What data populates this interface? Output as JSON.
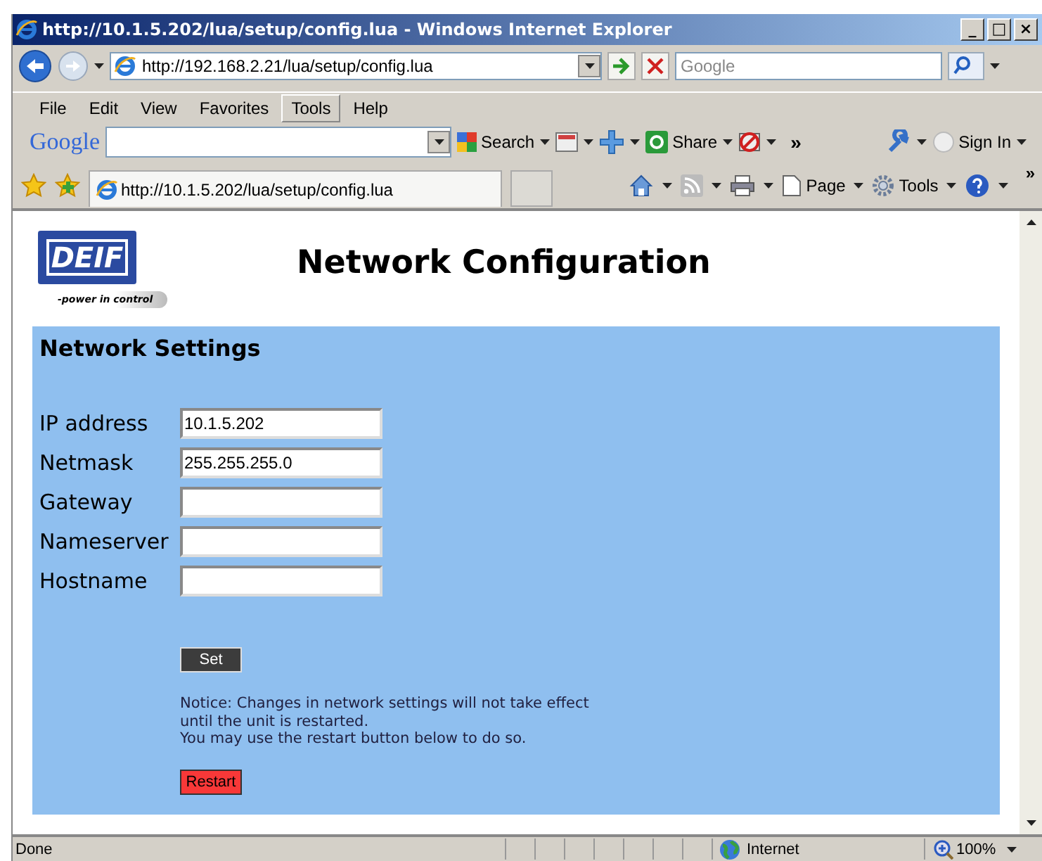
{
  "window": {
    "title": "http://10.1.5.202/lua/setup/config.lua - Windows Internet Explorer",
    "controls": [
      "_",
      "□",
      "×"
    ]
  },
  "nav": {
    "address": "http://192.168.2.21/lua/setup/config.lua",
    "search": {
      "placeholder": "Google"
    }
  },
  "menu": [
    {
      "label": "File",
      "selected": false
    },
    {
      "label": "Edit",
      "selected": false
    },
    {
      "label": "View",
      "selected": false
    },
    {
      "label": "Favorites",
      "selected": false
    },
    {
      "label": "Tools",
      "selected": true
    },
    {
      "label": "Help",
      "selected": false
    }
  ],
  "google_toolbar": {
    "logo": "Google",
    "search_button": "Search",
    "share_button": "Share",
    "more": "»",
    "sign_in": "Sign In"
  },
  "tab": {
    "title": "http://10.1.5.202/lua/setup/config.lua"
  },
  "command_bar": {
    "page": "Page",
    "tools": "Tools",
    "more": "»"
  },
  "page": {
    "logo": "DEIF",
    "tagline": "-power in control",
    "heading": "Network Configuration",
    "section": "Network Settings",
    "fields": [
      {
        "label": "IP address",
        "value": "10.1.5.202"
      },
      {
        "label": "Netmask",
        "value": "255.255.255.0"
      },
      {
        "label": "Gateway"
      },
      {
        "label": "Nameserver"
      },
      {
        "label": "Hostname"
      }
    ],
    "set_button": "Set",
    "notice": [
      "Notice: Changes in network settings will not take effect",
      "until the unit is restarted.",
      "You may use the restart button below to do so."
    ],
    "restart_button": "Restart"
  },
  "status_bar": {
    "text": "Done",
    "zone": "Internet",
    "zoom": "100%"
  }
}
